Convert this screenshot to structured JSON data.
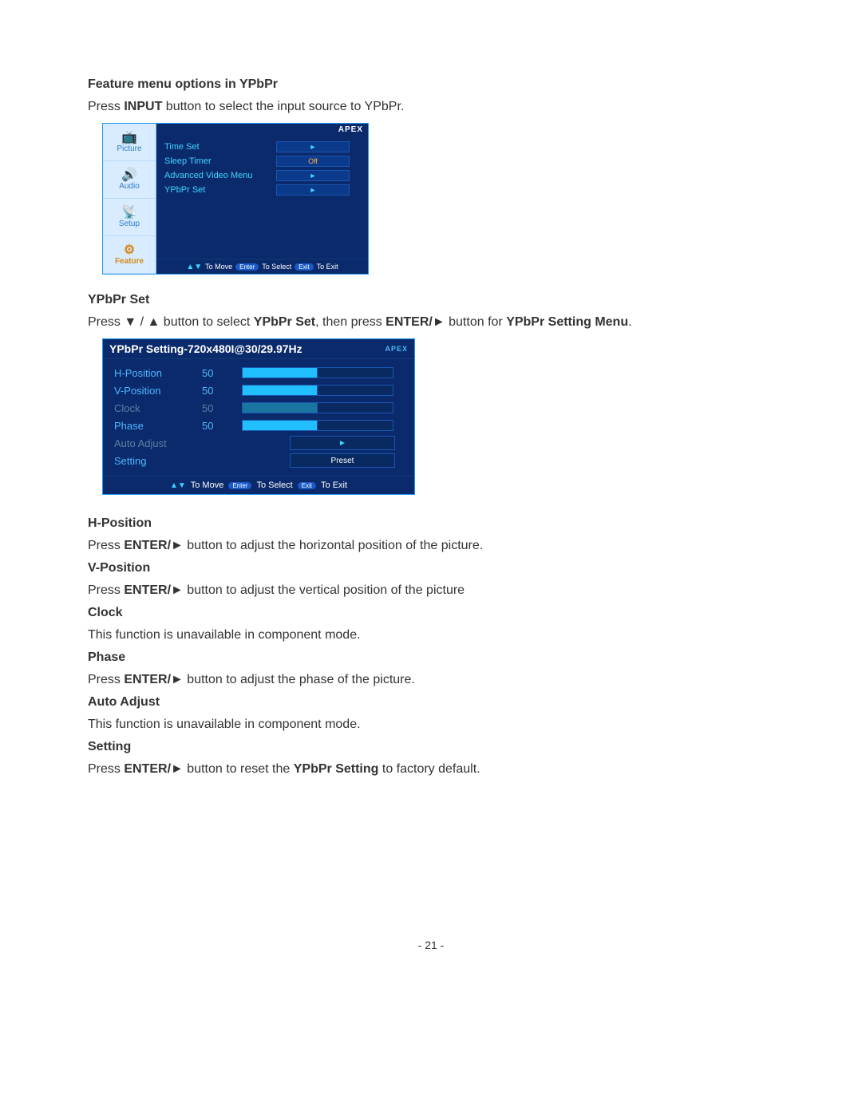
{
  "heading1": "Feature menu options in YPbPr",
  "intro1_a": "Press ",
  "intro1_b": "INPUT",
  "intro1_c": " button to select the input source to YPbPr.",
  "osd1": {
    "brand": "APEX",
    "tabs": {
      "picture": "Picture",
      "audio": "Audio",
      "setup": "Setup",
      "feature": "Feature"
    },
    "rows": {
      "timeSet": {
        "label": "Time Set",
        "value": "►"
      },
      "sleepTimer": {
        "label": "Sleep Timer",
        "value": "Off"
      },
      "advVideo": {
        "label": "Advanced Video Menu",
        "value": "►"
      },
      "ypbprSet": {
        "label": "YPbPr Set",
        "value": "►"
      }
    },
    "foot": {
      "move_sym": "▲▼",
      "move": "To Move",
      "enter_pill": "Enter",
      "select": "To Select",
      "exit_pill": "Exit",
      "exit": "To Exit"
    }
  },
  "heading2": "YPbPr Set",
  "line2_a": "Press ▼ / ▲ button to select ",
  "line2_b": "YPbPr Set",
  "line2_c": ", then press ",
  "line2_d": "ENTER/►",
  "line2_e": " button for ",
  "line2_f": "YPbPr    Setting Menu",
  "line2_g": ".",
  "osd2": {
    "title": "YPbPr Setting-720x480I@30/29.97Hz",
    "brand": "APEX",
    "rows": {
      "hpos": {
        "label": "H-Position",
        "value": "50"
      },
      "vpos": {
        "label": "V-Position",
        "value": "50"
      },
      "clock": {
        "label": "Clock",
        "value": "50"
      },
      "phase": {
        "label": "Phase",
        "value": "50"
      },
      "auto": {
        "label": "Auto Adjust",
        "value": "►"
      },
      "setting": {
        "label": "Setting",
        "value": "Preset"
      }
    },
    "foot": {
      "move_sym": "▲▼",
      "move": "To Move",
      "enter_pill": "Enter",
      "select": "To Select",
      "exit_pill": "Exit",
      "exit": "To Exit"
    }
  },
  "defs": {
    "hpos_h": "H-Position",
    "hpos_t_a": "Press ",
    "hpos_t_b": "ENTER/►",
    "hpos_t_c": " button to adjust the horizontal position of the picture.",
    "vpos_h": "V-Position",
    "vpos_t_a": "Press ",
    "vpos_t_b": "ENTER/►",
    "vpos_t_c": " button to adjust the vertical position of the picture",
    "clock_h": "Clock",
    "clock_t": "This function is unavailable in component mode.",
    "phase_h": "Phase",
    "phase_t_a": "Press ",
    "phase_t_b": "ENTER/►",
    "phase_t_c": " button to adjust the phase of the picture.",
    "auto_h": "Auto Adjust",
    "auto_t": "This function is unavailable in component mode.",
    "setting_h": "Setting",
    "setting_t_a": "Press ",
    "setting_t_b": "ENTER/►",
    "setting_t_c": " button to reset the ",
    "setting_t_d": "YPbPr Setting",
    "setting_t_e": " to factory default."
  },
  "page_no": "- 21 -"
}
